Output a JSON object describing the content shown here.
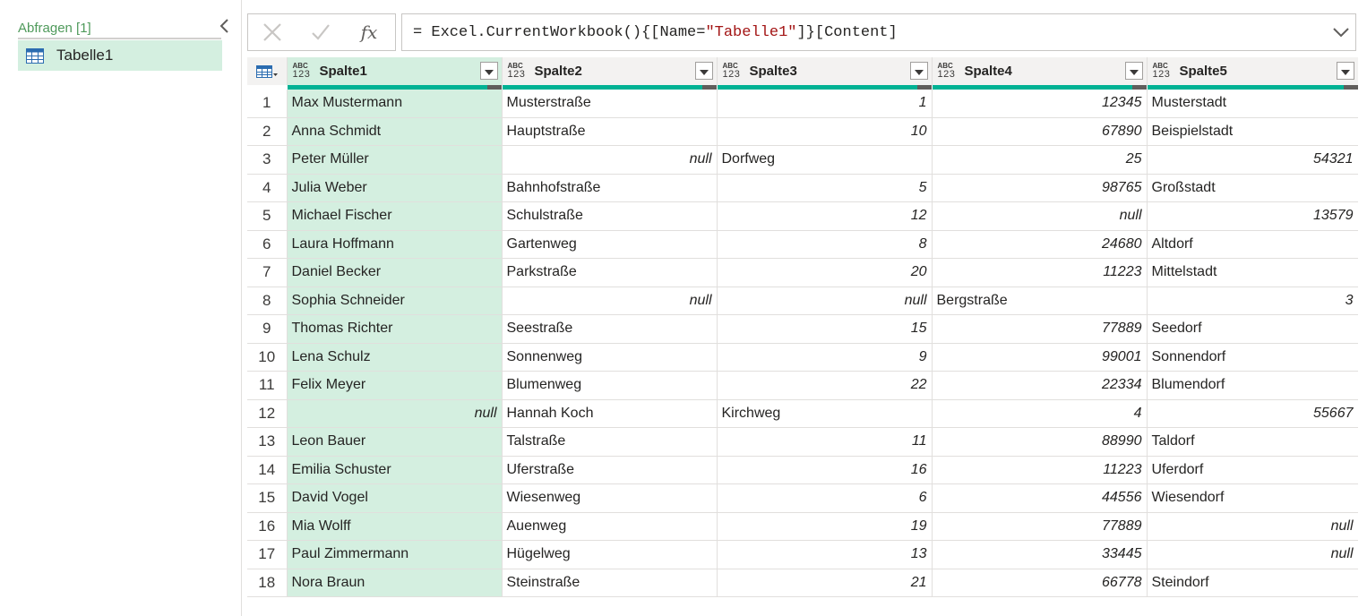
{
  "queries_pane": {
    "title": "Abfragen [1]",
    "items": [
      {
        "label": "Tabelle1",
        "icon": "table-icon"
      }
    ],
    "collapse_icon": "chevron-left-icon"
  },
  "formula_bar": {
    "cancel_icon": "close-icon",
    "confirm_icon": "checkmark-icon",
    "fx_label": "fx",
    "formula_parts": [
      "= Excel.CurrentWorkbook(){[Name=",
      "\"Tabelle1\"",
      "]}[Content]"
    ],
    "expand_icon": "chevron-down-icon"
  },
  "grid": {
    "corner_icon": "table-menu-icon",
    "type_icon_top": "ABC",
    "type_icon_bottom": "123",
    "columns": [
      "Spalte1",
      "Spalte2",
      "Spalte3",
      "Spalte4",
      "Spalte5"
    ],
    "rows": [
      [
        "Max Mustermann",
        "Musterstraße",
        "1",
        "12345",
        "Musterstadt"
      ],
      [
        "Anna Schmidt",
        "Hauptstraße",
        "10",
        "67890",
        "Beispielstadt"
      ],
      [
        "Peter Müller",
        "null",
        "Dorfweg",
        "25",
        "54321"
      ],
      [
        "Julia Weber",
        "Bahnhofstraße",
        "5",
        "98765",
        "Großstadt"
      ],
      [
        "Michael Fischer",
        "Schulstraße",
        "12",
        "null",
        "13579"
      ],
      [
        "Laura Hoffmann",
        "Gartenweg",
        "8",
        "24680",
        "Altdorf"
      ],
      [
        "Daniel Becker",
        "Parkstraße",
        "20",
        "11223",
        "Mittelstadt"
      ],
      [
        "Sophia Schneider",
        "null",
        "null",
        "Bergstraße",
        "3"
      ],
      [
        "Thomas Richter",
        "Seestraße",
        "15",
        "77889",
        "Seedorf"
      ],
      [
        "Lena Schulz",
        "Sonnenweg",
        "9",
        "99001",
        "Sonnendorf"
      ],
      [
        "Felix Meyer",
        "Blumenweg",
        "22",
        "22334",
        "Blumendorf"
      ],
      [
        "null",
        "Hannah Koch",
        "Kirchweg",
        "4",
        "55667"
      ],
      [
        "Leon Bauer",
        "Talstraße",
        "11",
        "88990",
        "Taldorf"
      ],
      [
        "Emilia Schuster",
        "Uferstraße",
        "16",
        "11223",
        "Uferdorf"
      ],
      [
        "David Vogel",
        "Wiesenweg",
        "6",
        "44556",
        "Wiesendorf"
      ],
      [
        "Mia Wolff",
        "Auenweg",
        "19",
        "77889",
        "null"
      ],
      [
        "Paul Zimmermann",
        "Hügelweg",
        "13",
        "33445",
        "null"
      ],
      [
        "Nora Braun",
        "Steinstraße",
        "21",
        "66778",
        "Steindorf"
      ]
    ],
    "quality_bar_color": "#00b294",
    "selected_column_color": "#d4efe0"
  }
}
